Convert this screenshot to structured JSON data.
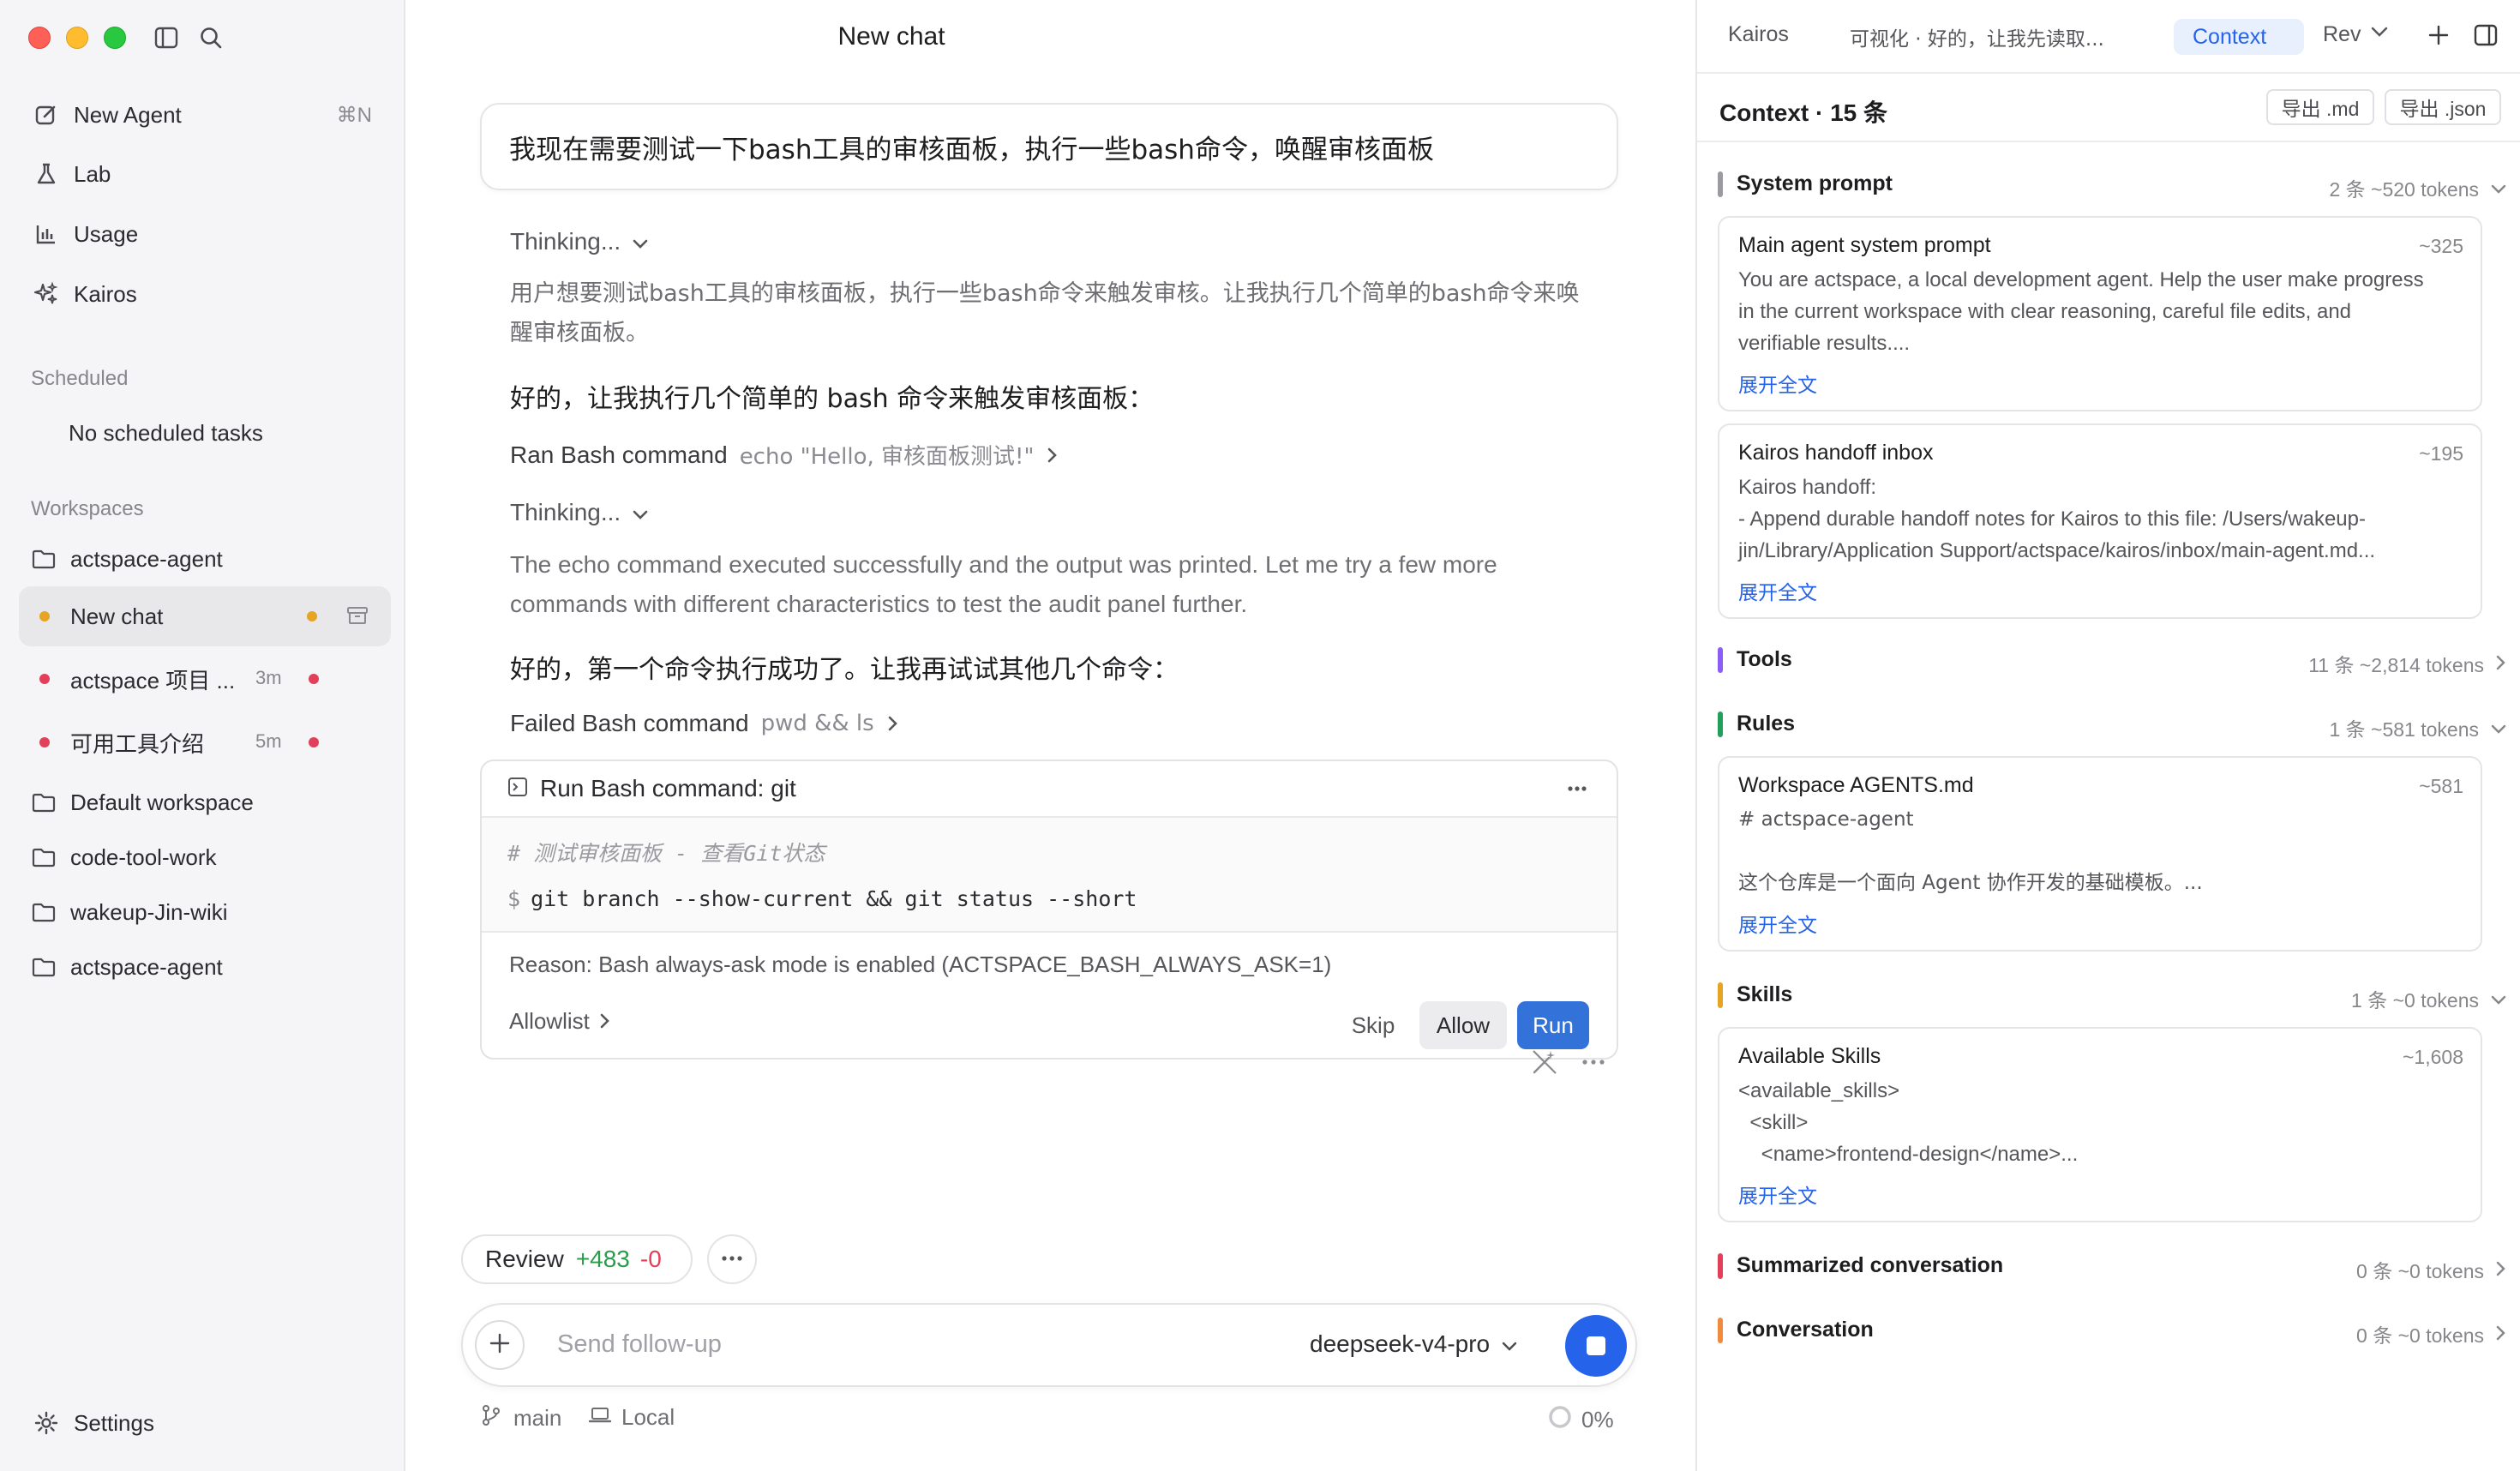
{
  "window": {
    "title": "New chat"
  },
  "sidebar": {
    "nav": [
      {
        "label": "New Agent",
        "shortcut": "⌘N",
        "icon": "compose-icon"
      },
      {
        "label": "Lab",
        "icon": "flask-icon"
      },
      {
        "label": "Usage",
        "icon": "bar-chart-icon"
      },
      {
        "label": "Kairos",
        "icon": "sparkle-icon"
      }
    ],
    "scheduled": {
      "title": "Scheduled",
      "empty": "No scheduled tasks"
    },
    "workspaces": {
      "title": "Workspaces",
      "items": [
        {
          "label": "actspace-agent",
          "type": "folder"
        },
        {
          "label": "New chat",
          "type": "chat-active"
        },
        {
          "label": "actspace 项目 ...",
          "type": "chat",
          "time": "3m"
        },
        {
          "label": "可用工具介绍",
          "type": "chat",
          "time": "5m"
        },
        {
          "label": "Default workspace",
          "type": "folder"
        },
        {
          "label": "code-tool-work",
          "type": "folder"
        },
        {
          "label": "wakeup-Jin-wiki",
          "type": "folder"
        },
        {
          "label": "actspace-agent",
          "type": "folder"
        }
      ]
    },
    "settings_label": "Settings"
  },
  "chat": {
    "user_message": "我现在需要测试一下bash工具的审核面板，执行一些bash命令，唤醒审核面板",
    "thinking_label": "Thinking...",
    "thinking_1": "用户想要测试bash工具的审核面板，执行一些bash命令来触发审核。让我执行几个简单的bash命令来唤醒审核面板。",
    "answer_1": "好的，让我执行几个简单的 bash 命令来触发审核面板：",
    "tool_1": {
      "label": "Ran Bash command",
      "value": "echo \"Hello, 审核面板测试!\""
    },
    "thinking_2": "The echo command executed successfully and the output was printed. Let me try a few more commands with different characteristics to test the audit panel further.",
    "answer_2": "好的，第一个命令执行成功了。让我再试试其他几个命令：",
    "tool_2": {
      "label": "Failed Bash command",
      "value": "pwd && ls"
    },
    "bash_card": {
      "title": "Run Bash command: git",
      "comment": "# 测试审核面板 - 查看Git状态",
      "prompt": "$",
      "command": "git branch --show-current && git status --short",
      "reason": "Reason: Bash always-ask mode is enabled (ACTSPACE_BASH_ALWAYS_ASK=1)",
      "allowlist": "Allowlist",
      "skip": "Skip",
      "allow": "Allow",
      "run": "Run"
    }
  },
  "review": {
    "label": "Review",
    "added": "+483",
    "removed": "-0"
  },
  "composer": {
    "placeholder": "Send follow-up",
    "model": "deepseek-v4-pro"
  },
  "status": {
    "branch": "main",
    "location": "Local",
    "progress": "0%"
  },
  "right_panel": {
    "tabs": [
      "Kairos",
      "可视化 · 好的，让我先读取...",
      "Context",
      "Rev"
    ],
    "header": "Context · 15 条",
    "export_md": "导出 .md",
    "export_json": "导出 .json",
    "expand_label": "展开全文",
    "sections": [
      {
        "name": "System prompt",
        "meta": "2 条 ~520 tokens",
        "color": "#9a9aa0",
        "expanded": true
      },
      {
        "name": "Tools",
        "meta": "11 条 ~2,814 tokens",
        "color": "#8b5cf6",
        "expanded": false
      },
      {
        "name": "Rules",
        "meta": "1 条 ~581 tokens",
        "color": "#22a05b",
        "expanded": true
      },
      {
        "name": "Skills",
        "meta": "1 条 ~0 tokens",
        "color": "#e5a422",
        "expanded": true
      },
      {
        "name": "Summarized conversation",
        "meta": "0 条 ~0 tokens",
        "color": "#e2405a",
        "expanded": false
      },
      {
        "name": "Conversation",
        "meta": "0 条 ~0 tokens",
        "color": "#f08a3c",
        "expanded": false
      }
    ],
    "cards": [
      {
        "title": "Main agent system prompt",
        "tokens": "~325",
        "body": "You are actspace, a local development agent. Help the user make progress\nin the current workspace with clear reasoning, careful file edits, and\nverifiable results...."
      },
      {
        "title": "Kairos handoff inbox",
        "tokens": "~195",
        "body": "Kairos handoff:\n- Append durable handoff notes for Kairos to this file: /Users/wakeup-\njin/Library/Application Support/actspace/kairos/inbox/main-agent.md..."
      },
      {
        "title": "Workspace AGENTS.md",
        "tokens": "~581",
        "body": "# actspace-agent\n\n这个仓库是一个面向 Agent 协作开发的基础模板。..."
      },
      {
        "title": "Available Skills",
        "tokens": "~1,608",
        "body": "<available_skills>\n  <skill>\n    <name>frontend-design</name>..."
      }
    ]
  }
}
